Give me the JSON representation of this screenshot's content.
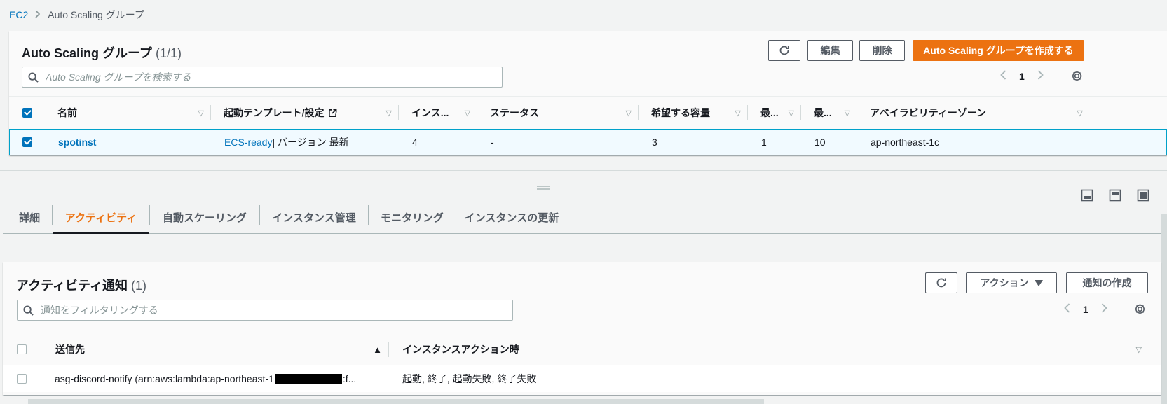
{
  "breadcrumb": {
    "root": "EC2",
    "current": "Auto Scaling グループ"
  },
  "asg_panel": {
    "title": "Auto Scaling グループ",
    "count": "(1/1)",
    "buttons": {
      "edit": "編集",
      "delete": "削除",
      "create": "Auto Scaling グループを作成する"
    },
    "search_placeholder": "Auto Scaling グループを検索する",
    "page": "1",
    "columns": [
      "名前",
      "起動テンプレート/設定",
      "インス...",
      "ステータス",
      "希望する容量",
      "最...",
      "最...",
      "アベイラビリティーゾーン"
    ],
    "rows": [
      {
        "name": "spotinst",
        "template_link": "ECS-ready",
        "template_suffix": " | バージョン 最新",
        "instances": "4",
        "status": "-",
        "desired": "3",
        "min": "1",
        "max": "10",
        "az": "ap-northeast-1c"
      }
    ]
  },
  "tabs": [
    "詳細",
    "アクティビティ",
    "自動スケーリング",
    "インスタンス管理",
    "モニタリング",
    "インスタンスの更新"
  ],
  "active_tab": 1,
  "notify_panel": {
    "title": "アクティビティ通知",
    "count": "(1)",
    "buttons": {
      "actions": "アクション",
      "create": "通知の作成"
    },
    "search_placeholder": "通知をフィルタリングする",
    "page": "1",
    "columns": [
      "送信先",
      "インスタンスアクション時"
    ],
    "rows": [
      {
        "destination_prefix": "asg-discord-notify (arn:aws:lambda:ap-northeast-1",
        "destination_suffix": ":f...",
        "actions": "起動, 終了, 起動失敗, 終了失敗"
      }
    ]
  },
  "colors": {
    "accent": "#ec7211",
    "link": "#0073bb",
    "selected_border": "#00a1c9"
  }
}
